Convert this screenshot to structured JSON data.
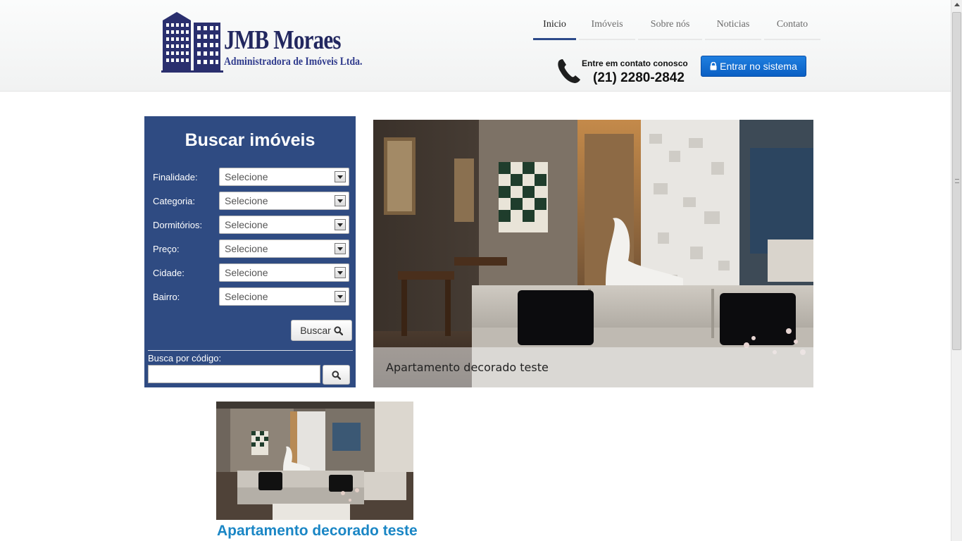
{
  "brand": {
    "title": "JMB Moraes",
    "subtitle": "Administradora de Imóveis Ltda."
  },
  "nav": {
    "items": [
      {
        "label": "Inicio",
        "active": true
      },
      {
        "label": "Imóveis",
        "active": false
      },
      {
        "label": "Sobre nós",
        "active": false
      },
      {
        "label": "Noticias",
        "active": false
      },
      {
        "label": "Contato",
        "active": false
      }
    ]
  },
  "contact": {
    "label": "Entre em contato conosco",
    "phone": "(21) 2280-2842"
  },
  "login": {
    "label": "Entrar no sistema"
  },
  "search": {
    "title": "Buscar imóveis",
    "fields": [
      {
        "label": "Finalidade:",
        "value": "Selecione"
      },
      {
        "label": "Categoria:",
        "value": "Selecione"
      },
      {
        "label": "Dormitórios:",
        "value": "Selecione"
      },
      {
        "label": "Preço:",
        "value": "Selecione"
      },
      {
        "label": "Cidade:",
        "value": "Selecione"
      },
      {
        "label": "Bairro:",
        "value": "Selecione"
      }
    ],
    "submit_label": "Buscar",
    "code_label": "Busca por código:",
    "code_value": ""
  },
  "slider": {
    "caption": "Apartamento decorado teste"
  },
  "listing": {
    "title": "Apartamento decorado teste"
  },
  "colors": {
    "panel": "#2f4b82",
    "nav_active": "#2d4a8a",
    "login_button": "#0a5fc4",
    "listing_title": "#1a86c5"
  }
}
